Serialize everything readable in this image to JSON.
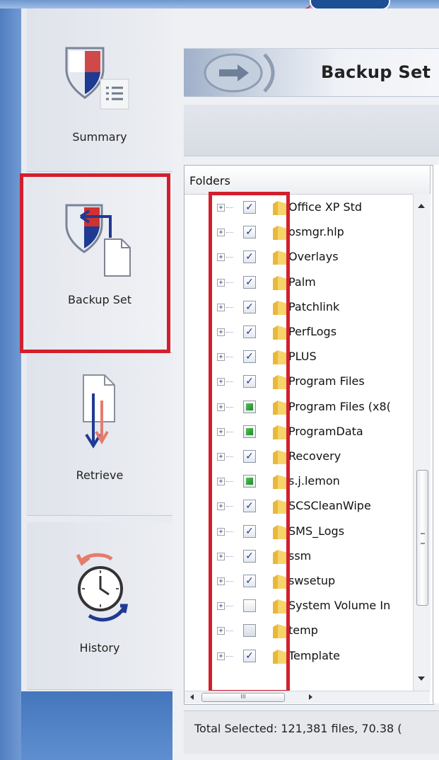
{
  "nav": {
    "items": [
      {
        "id": "summary",
        "label": "Summary",
        "icon": "summary-icon"
      },
      {
        "id": "backup_set",
        "label": "Backup Set",
        "icon": "backup-set-icon",
        "selected": true
      },
      {
        "id": "retrieve",
        "label": "Retrieve",
        "icon": "retrieve-icon"
      },
      {
        "id": "history",
        "label": "History",
        "icon": "history-icon"
      }
    ]
  },
  "header": {
    "title": "Backup Set",
    "icon": "arrow-right-icon"
  },
  "tree": {
    "column_header": "Folders",
    "rows": [
      {
        "name": "Office XP Std",
        "check": "checked"
      },
      {
        "name": "osmgr.hlp",
        "check": "checked"
      },
      {
        "name": "Overlays",
        "check": "checked"
      },
      {
        "name": "Palm",
        "check": "checked"
      },
      {
        "name": "Patchlink",
        "check": "checked"
      },
      {
        "name": "PerfLogs",
        "check": "checked"
      },
      {
        "name": "PLUS",
        "check": "checked"
      },
      {
        "name": "Program Files",
        "check": "checked"
      },
      {
        "name": "Program Files (x8(",
        "check": "partial"
      },
      {
        "name": "ProgramData",
        "check": "partial"
      },
      {
        "name": "Recovery",
        "check": "checked"
      },
      {
        "name": "s.j.lemon",
        "check": "partial"
      },
      {
        "name": "SCSCleanWipe",
        "check": "checked"
      },
      {
        "name": "SMS_Logs",
        "check": "checked"
      },
      {
        "name": "ssm",
        "check": "checked"
      },
      {
        "name": "swsetup",
        "check": "checked"
      },
      {
        "name": "System Volume In",
        "check": "unchecked"
      },
      {
        "name": "temp",
        "check": "grey"
      },
      {
        "name": "Template",
        "check": "checked"
      }
    ],
    "expander_symbol": "+",
    "check_symbol": "✓",
    "hscroll_grip": "III",
    "vscroll_grip": "≡"
  },
  "status": {
    "text": "Total Selected: 121,381 files, 70.38 ("
  },
  "colors": {
    "highlight": "#d31f2d",
    "brand_blue": "#1d4f93",
    "check_blue": "#1f3a93",
    "partial_green": "#2f9a3a",
    "folder_yellow": "#f2c94c"
  }
}
